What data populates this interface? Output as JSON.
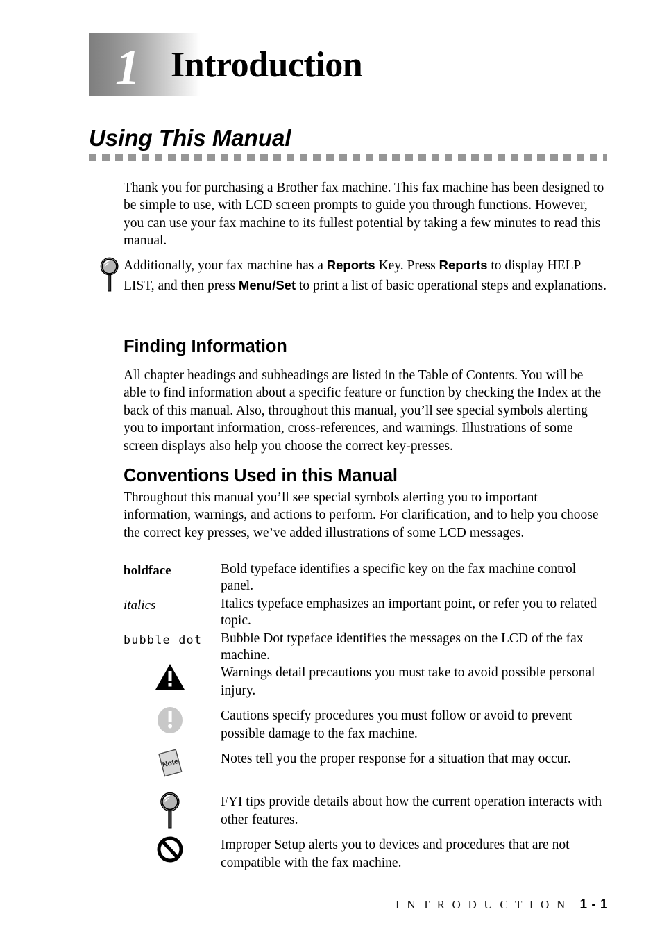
{
  "chapter": {
    "number": "1",
    "title": "Introduction"
  },
  "section": {
    "heading": "Using This Manual",
    "intro_paragraph": "Thank you for purchasing a Brother fax machine. This fax machine has been designed to be simple to use, with LCD screen prompts to guide you through functions. However, you can use your fax machine to its fullest potential by taking a few minutes to read this manual."
  },
  "tip": {
    "icon": "magnifier-icon",
    "part1": "Additionally, your fax machine has a ",
    "key1": "Reports",
    "part2": " Key. Press ",
    "key2": "Reports",
    "part3": " to display HELP LIST, and then press ",
    "key3": "Menu/Set",
    "part4": " to print a list of basic operational steps and explanations."
  },
  "finding_information": {
    "heading": "Finding Information",
    "paragraph": "All chapter headings and subheadings are listed in the Table of Contents. You will be able to find information about a specific feature or function by checking the Index at the back of this manual. Also, throughout this manual, you’ll see special symbols alerting you to important information, cross-references, and warnings. Illustrations of some screen displays also help you choose the correct key-presses."
  },
  "conventions": {
    "heading": "Conventions Used in this Manual",
    "paragraph": "Throughout this manual you’ll see special symbols alerting you to important information, warnings, and actions to perform. For clarification, and to help you choose the correct key presses, we’ve added illustrations of some LCD messages.",
    "typefaces": [
      {
        "term": "boldface",
        "style": "bold",
        "description": "Bold typeface identifies a specific key on the fax machine control panel."
      },
      {
        "term": "italics",
        "style": "italic",
        "description": "Italics typeface emphasizes an important point, or refer you to related topic."
      },
      {
        "term": "bubble dot",
        "style": "dotmatrix",
        "description": "Bubble Dot typeface identifies the messages on the LCD of the fax machine."
      }
    ]
  },
  "legend": [
    {
      "icon": "warning-triangle-icon",
      "text": "Warnings detail precautions you must take to avoid possible personal injury."
    },
    {
      "icon": "caution-circle-icon",
      "text": "Cautions specify procedures you must follow or avoid to prevent possible damage to the fax machine."
    },
    {
      "icon": "note-page-icon",
      "note_label": "Note",
      "text": "Notes tell you the proper response for a situation that may occur."
    },
    {
      "icon": "magnifier-icon",
      "text": "FYI tips provide details about how the current operation interacts with other features."
    },
    {
      "icon": "no-entry-icon",
      "text": "Improper Setup alerts you to devices and procedures that are not compatible with the fax machine."
    }
  ],
  "footer": {
    "label": "I N T R O D U C T I O N",
    "page": "1 - 1"
  },
  "colors": {
    "badge_gradient_start": "#7e7e7e",
    "badge_gradient_end": "#ffffff",
    "dash_rule": "#969696",
    "caution_gray": "#c8c8c8",
    "note_gray": "#d4d4d4",
    "text": "#000000",
    "background": "#ffffff"
  }
}
